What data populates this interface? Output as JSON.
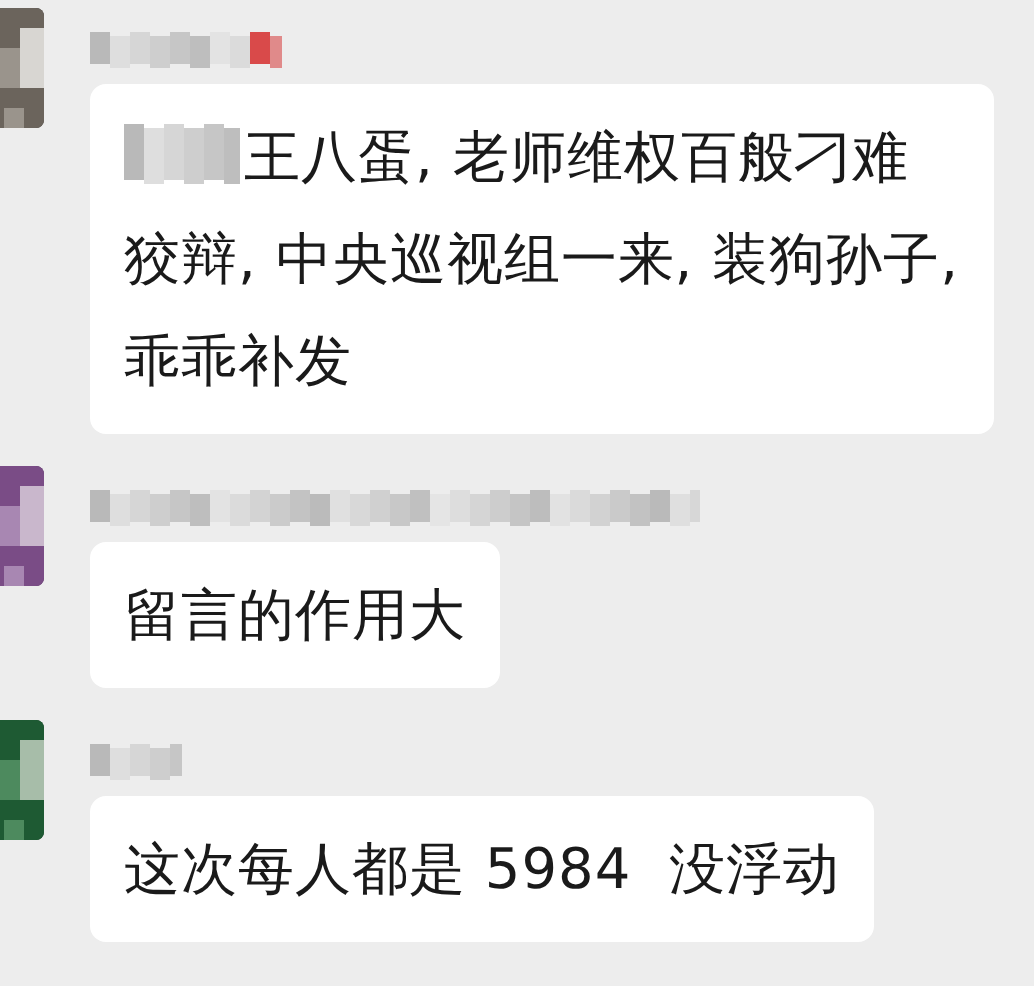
{
  "messages": [
    {
      "redacted_prefix": true,
      "text": "王八蛋, 老师维权百般刁难狡辩, 中央巡视组一来, 装狗孙子, 乖乖补发"
    },
    {
      "redacted_prefix": false,
      "text": "留言的作用大"
    },
    {
      "redacted_prefix": false,
      "text": "这次每人都是 5984  没浮动"
    }
  ]
}
